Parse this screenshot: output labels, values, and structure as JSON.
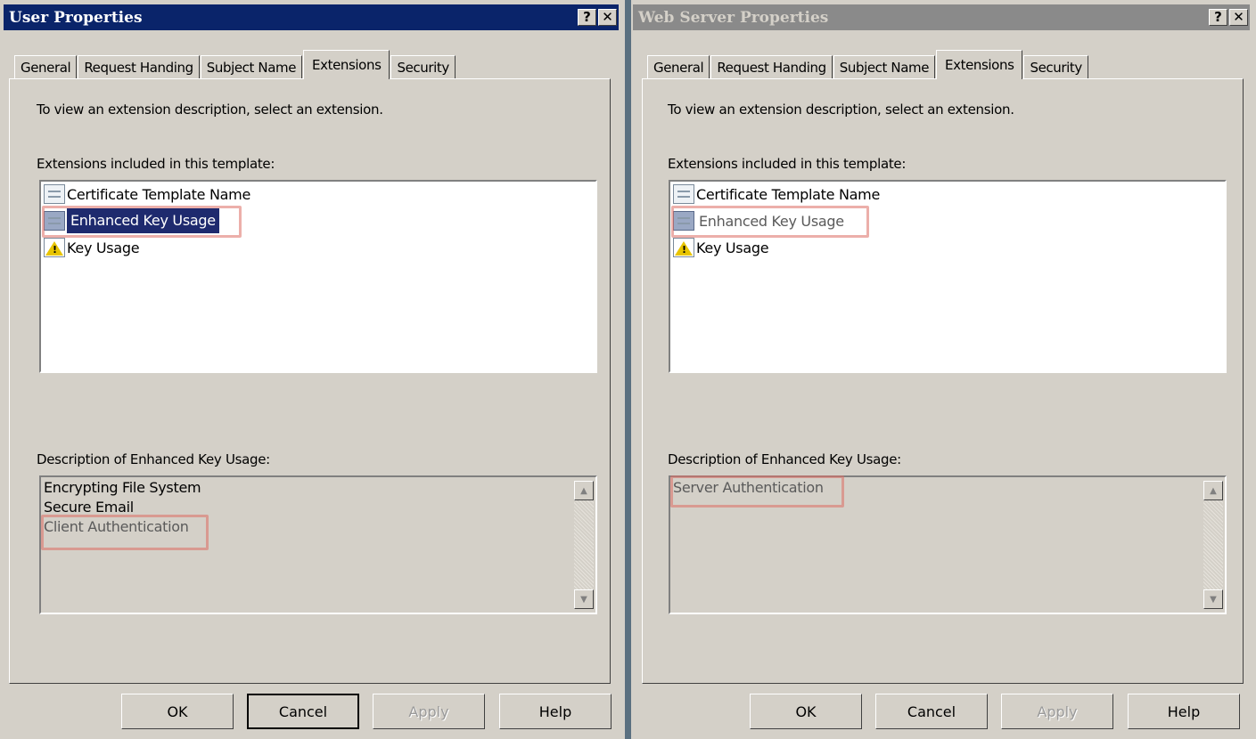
{
  "left": {
    "title": "User Properties",
    "help_btn": "?",
    "close_btn": "✕",
    "tabs": [
      "General",
      "Request Handing",
      "Subject Name",
      "Extensions",
      "Security"
    ],
    "selected_tab": "Extensions",
    "instruction": "To view an extension description, select an extension.",
    "list_label": "Extensions included in this template:",
    "extensions": [
      "Certificate Template Name",
      "Enhanced Key Usage",
      "Key Usage"
    ],
    "desc_label": "Description of Enhanced Key Usage:",
    "description": [
      "Encrypting File System",
      "Secure Email",
      "Client Authentication"
    ],
    "buttons": {
      "ok": "OK",
      "cancel": "Cancel",
      "apply": "Apply",
      "help": "Help"
    }
  },
  "right": {
    "title": "Web Server Properties",
    "help_btn": "?",
    "close_btn": "✕",
    "tabs": [
      "General",
      "Request Handing",
      "Subject Name",
      "Extensions",
      "Security"
    ],
    "selected_tab": "Extensions",
    "instruction": "To view an extension description, select an extension.",
    "list_label": "Extensions included in this template:",
    "extensions": [
      "Certificate Template Name",
      "Enhanced Key Usage",
      "Key Usage"
    ],
    "desc_label": "Description of Enhanced Key Usage:",
    "description": [
      "Server Authentication"
    ],
    "buttons": {
      "ok": "OK",
      "cancel": "Cancel",
      "apply": "Apply",
      "help": "Help"
    }
  },
  "colors": {
    "active_title": "#0a246a",
    "inactive_title": "#8a8a8a",
    "selection": "#1e2a6e",
    "highlight": "#dc6e64"
  }
}
